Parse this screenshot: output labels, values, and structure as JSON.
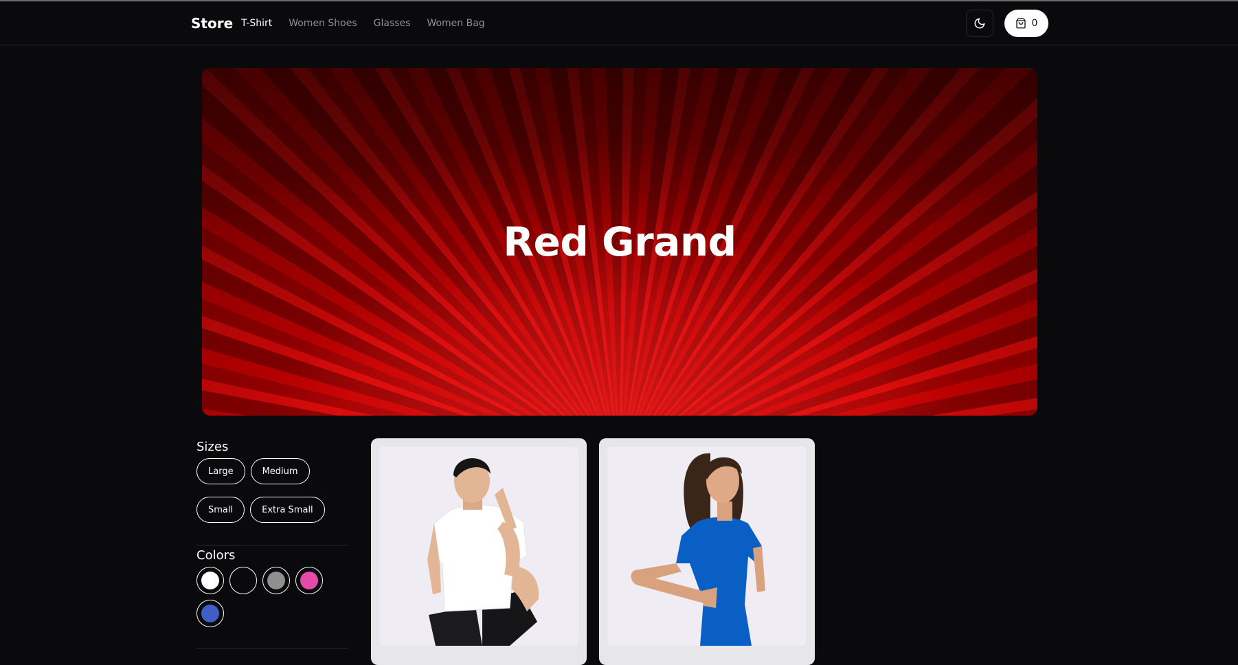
{
  "nav": {
    "brand": "Store",
    "links": [
      "T-Shirt",
      "Women Shoes",
      "Glasses",
      "Women Bag"
    ],
    "cart_count": "0"
  },
  "hero": {
    "title": "Red Grand"
  },
  "filters": {
    "sizes_heading": "Sizes",
    "sizes": [
      "Large",
      "Medium",
      "Small",
      "Extra Small"
    ],
    "colors_heading": "Colors",
    "colors": [
      "#ffffff",
      "#0a0a0c",
      "#8f8f8f",
      "#e64aa8",
      "#3d5fc7"
    ]
  },
  "products": [
    {
      "name": "white-tshirt-product",
      "shirt_color": "#ffffff"
    },
    {
      "name": "blue-tshirt-product",
      "shirt_color": "#0a5fc4"
    }
  ]
}
